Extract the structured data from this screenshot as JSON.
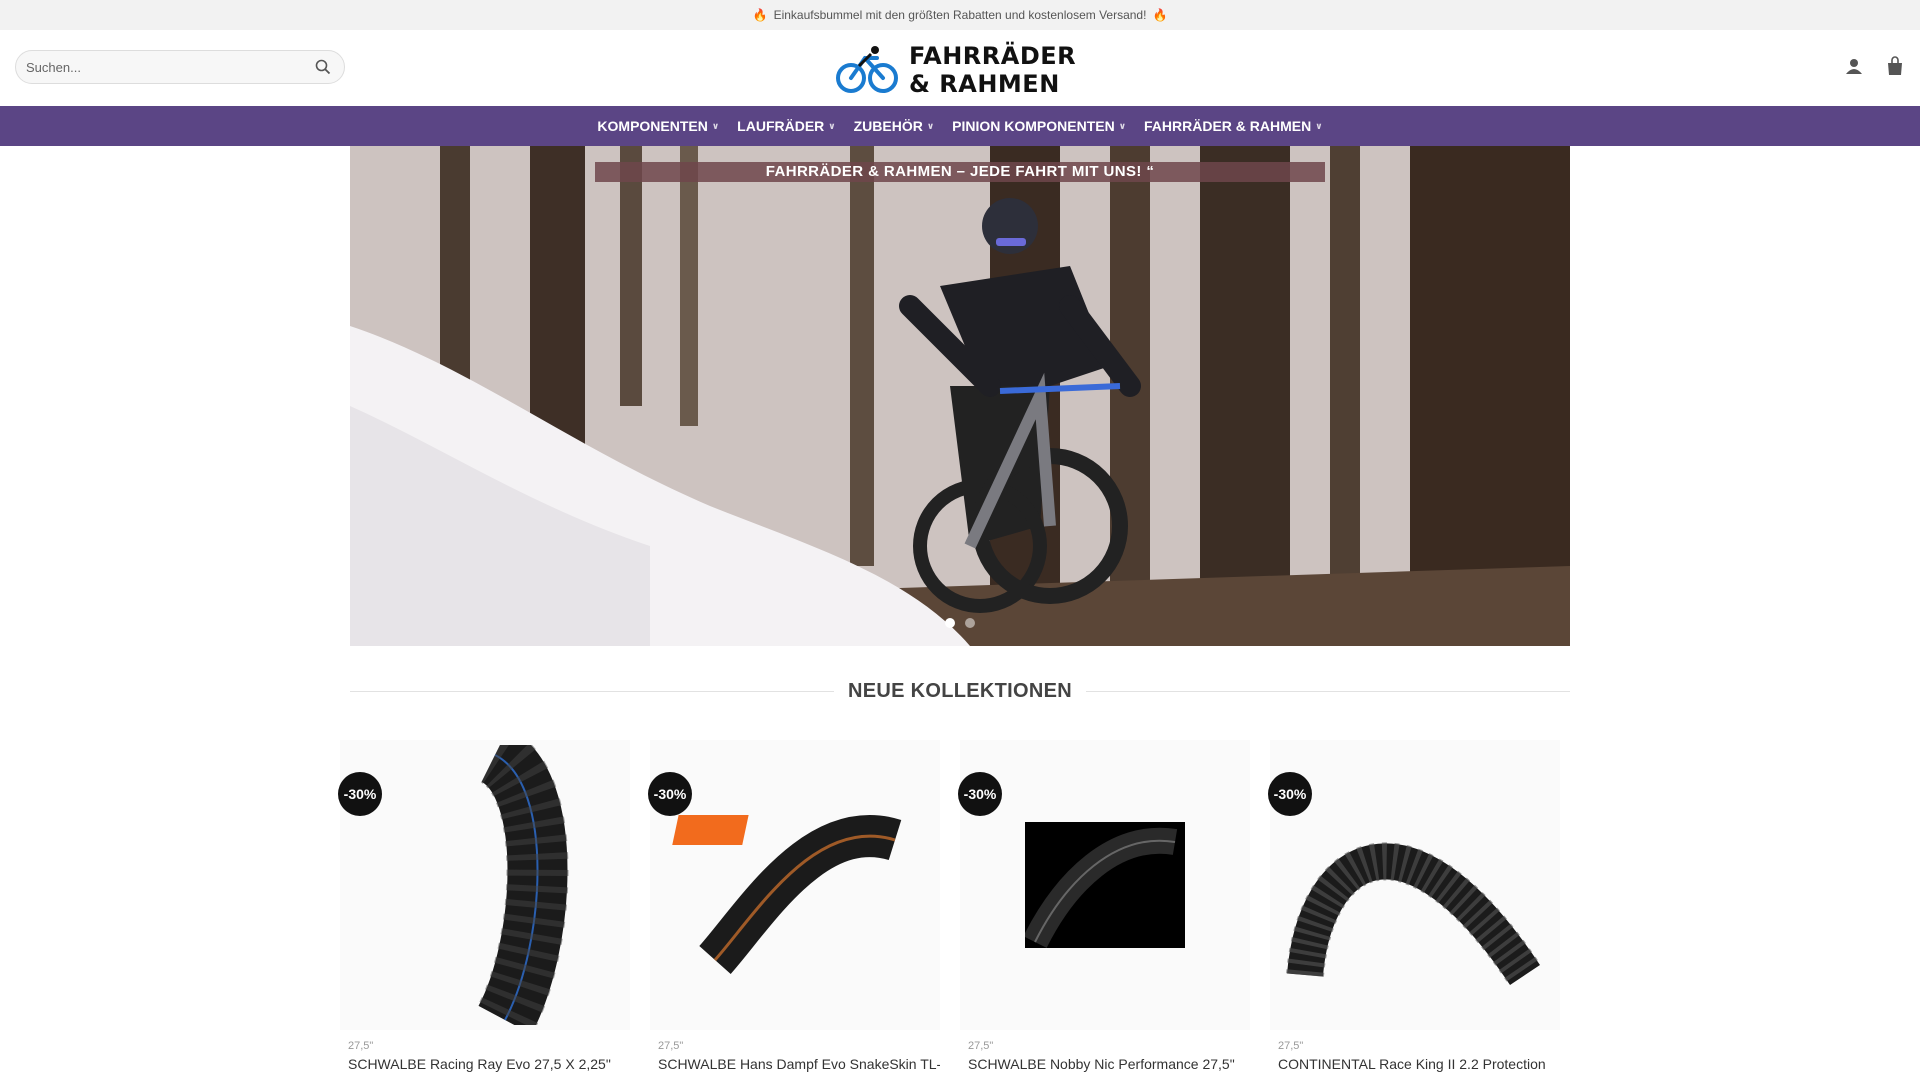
{
  "topbar": {
    "text": "Einkaufsbummel mit den größten Rabatten und kostenlosem Versand!",
    "icon": "flame-icon"
  },
  "search": {
    "placeholder": "Suchen..."
  },
  "logo": {
    "line1": "FAHRRÄDER",
    "line2": "& RAHMEN",
    "accent": "#1a7bd0"
  },
  "nav": {
    "items": [
      {
        "label": "KOMPONENTEN"
      },
      {
        "label": "LAUFRÄDER"
      },
      {
        "label": "ZUBEHÖR"
      },
      {
        "label": "PINION KOMPONENTEN"
      },
      {
        "label": "FAHRRÄDER & RAHMEN"
      }
    ],
    "color": "#5b4585"
  },
  "hero": {
    "banner": "FAHRRÄDER & RAHMEN – JEDE FAHRT MIT UNS! “",
    "slides": 2,
    "active_slide": 1
  },
  "section": {
    "title": "NEUE KOLLEKTIONEN"
  },
  "products": [
    {
      "badge": "-30%",
      "category": "27,5\"",
      "name": "SCHWALBE Racing Ray Evo 27,5 X 2,25\""
    },
    {
      "badge": "-30%",
      "category": "27,5\"",
      "name": "SCHWALBE Hans Dampf Evo SnakeSkin TL-"
    },
    {
      "badge": "-30%",
      "category": "27,5\"",
      "name": "SCHWALBE Nobby Nic Performance 27,5\""
    },
    {
      "badge": "-30%",
      "category": "27,5\"",
      "name": "CONTINENTAL Race King II 2.2 Protection"
    }
  ]
}
